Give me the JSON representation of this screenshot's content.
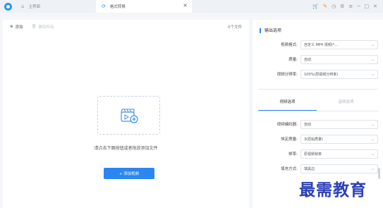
{
  "titlebar": {
    "tabs": [
      {
        "label": "主界面",
        "icon": "home-icon"
      },
      {
        "label": "格式转换",
        "icon": "convert-icon"
      }
    ],
    "close_tab": "×",
    "window_controls": [
      "cart-icon",
      "wrench-icon",
      "clock-icon",
      "settings-icon",
      "menu-icon",
      "minimize-icon",
      "maximize-icon",
      "close-icon"
    ]
  },
  "toolbar": {
    "add_label": "添加",
    "delete_all_label": "删除所有",
    "file_count": "0个文件"
  },
  "dropzone": {
    "hint": "请点击下面按钮或者拖放添加文件",
    "add_button": "+ 添加视频"
  },
  "output": {
    "title": "输出选项",
    "format_label": "视频格式:",
    "format_value": "自定义 MP4 视频(*...",
    "quality_label": "质量:",
    "quality_value": "自动",
    "resolution_label": "视频分辨率:",
    "resolution_value": "100%(原视频分辨率)"
  },
  "subtabs": {
    "video": "视频选项",
    "audio": "音频选项"
  },
  "video_options": {
    "encoder_label": "视频编码器:",
    "encoder_value": "自动",
    "const_quality_label": "恒定质量:",
    "const_quality_value": "3(原始质量)",
    "framerate_label": "帧率:",
    "framerate_value": "原视频帧率",
    "fill_label": "填充方式:",
    "fill_value": "填黑边"
  },
  "watermark": "最需教育",
  "colors": {
    "accent": "#2a86f0",
    "watermark": "#2a3fb8"
  }
}
